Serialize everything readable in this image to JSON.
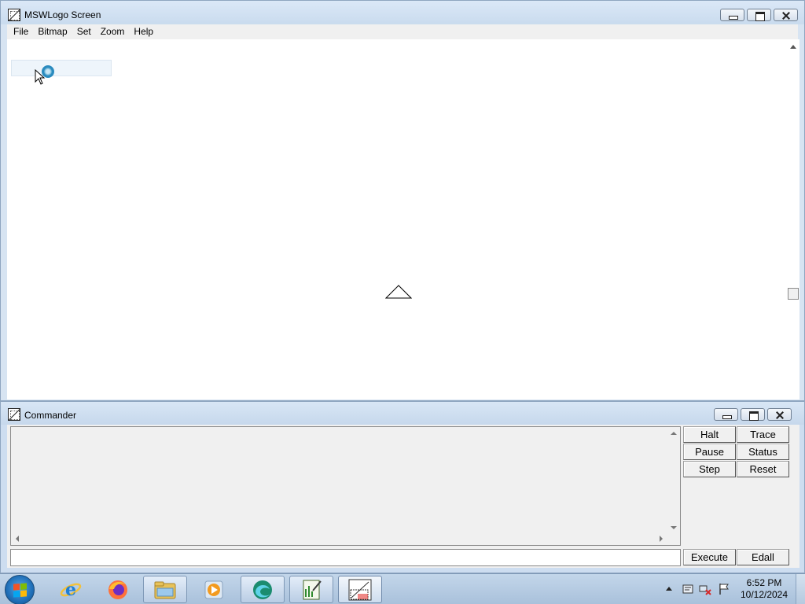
{
  "screen_window": {
    "title": "MSWLogo Screen",
    "menu": [
      "File",
      "Bitmap",
      "Set",
      "Zoom",
      "Help"
    ]
  },
  "commander_window": {
    "title": "Commander",
    "buttons": {
      "halt": "Halt",
      "trace": "Trace",
      "pause": "Pause",
      "status": "Status",
      "step": "Step",
      "reset": "Reset",
      "execute": "Execute",
      "edall": "Edall"
    },
    "input_value": ""
  },
  "taskbar": {
    "apps": [
      {
        "name": "internet-explorer-icon"
      },
      {
        "name": "firefox-icon"
      },
      {
        "name": "file-explorer-icon"
      },
      {
        "name": "media-player-icon"
      },
      {
        "name": "edge-icon"
      },
      {
        "name": "chart-editor-icon"
      },
      {
        "name": "mswlogo-icon"
      }
    ],
    "clock": {
      "time": "6:52 PM",
      "date": "10/12/2024"
    }
  },
  "colors": {
    "titlebar": "#d7e4f2",
    "canvas": "#ffffff",
    "taskbar": "#b5cbe2",
    "dialog_face": "#f0f0f0"
  }
}
